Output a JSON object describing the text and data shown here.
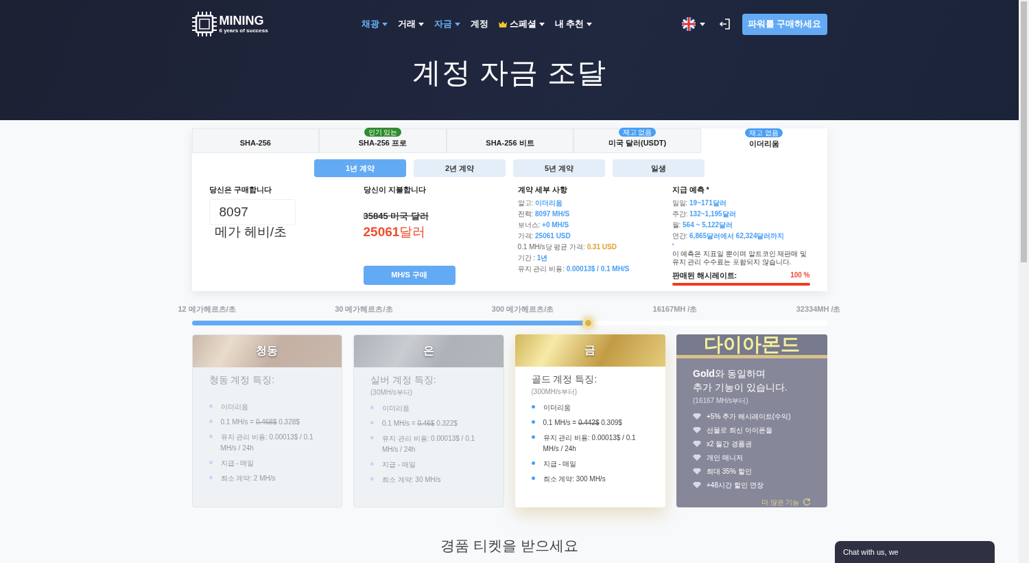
{
  "header": {
    "logo_name": "MINING",
    "logo_tagline": "6 years of success",
    "nav": [
      {
        "label": "채광",
        "selected": true,
        "dropdown": true,
        "crown": false
      },
      {
        "label": "거래",
        "selected": false,
        "dropdown": true,
        "crown": false
      },
      {
        "label": "자금",
        "selected": true,
        "dropdown": true,
        "crown": false
      },
      {
        "label": "계정",
        "selected": false,
        "dropdown": false,
        "crown": false
      },
      {
        "label": "스페셜",
        "selected": false,
        "dropdown": true,
        "crown": true
      },
      {
        "label": "내 추천",
        "selected": false,
        "dropdown": true,
        "crown": false
      }
    ],
    "buy_button": "파워를 구매하세요",
    "title": "계정 자금 조달"
  },
  "algo_tabs": [
    {
      "label": "SHA-256",
      "selected": false
    },
    {
      "label": "SHA-256 프로",
      "selected": false,
      "badge": "인기 있는",
      "color": "#2e8b2e"
    },
    {
      "label": "SHA-256 비트",
      "selected": false
    },
    {
      "label": "미국 달러(USDT)",
      "selected": false,
      "badge": "재고 없음",
      "color": "#4a9ff5"
    },
    {
      "label": "이더리움",
      "selected": true,
      "badge": "재고 없음",
      "color": "#4a9ff5"
    }
  ],
  "term_tabs": [
    {
      "label": "1년 계약",
      "selected": true
    },
    {
      "label": "2년 계약",
      "selected": false
    },
    {
      "label": "5년 계약",
      "selected": false
    },
    {
      "label": "일생",
      "selected": false
    }
  ],
  "buy": {
    "heading": "당신은 구매합니다",
    "value": "8097",
    "unit": "메가 헤비/초"
  },
  "pay": {
    "heading": "당신이 지불합니다",
    "old_price": "35845 미국 달러",
    "price": "25061",
    "currency": "달러",
    "button": "MH/S 구매"
  },
  "details": {
    "heading": "계약 세부 사항",
    "items": [
      {
        "label": "알고: ",
        "value": "이더리움",
        "color": "#4a9ff5"
      },
      {
        "label": "전력: ",
        "value": "8097 MH/S",
        "color": "#4a9ff5"
      },
      {
        "label": "보너스: ",
        "value": "+0 MH/S",
        "color": "#4a9ff5"
      },
      {
        "label": "가격: ",
        "value": "25061 USD",
        "color": "#4a9ff5"
      },
      {
        "label": "0.1 MH/s당 평균 가격: ",
        "value": "0.31 USD",
        "color": "#e0a030"
      },
      {
        "label": "기간 : ",
        "value": "1년",
        "color": "#4a9ff5"
      },
      {
        "label": "유지 관리 비용: ",
        "value": "0.00013$ / 0.1 MH/S",
        "color": "#4a9ff5"
      }
    ]
  },
  "forecast": {
    "heading": "지급 예측 *",
    "items": [
      {
        "label": "일일: ",
        "value": "19~171달러"
      },
      {
        "label": "주간: ",
        "value": "132~1,195달러"
      },
      {
        "label": "월: ",
        "value": "564 ~ 5,122달러"
      },
      {
        "label": "연간: ",
        "value": "6,865달러에서 62,324달러까지"
      }
    ],
    "star": "*",
    "note": "이 예측은 지표일 뿐이며 알트코인 재판매 및 유지 관리 수수료는 포함되지 않습니다.",
    "sold_label": "판매된 해시레이트:",
    "sold_value": "100 %",
    "level": 1
  },
  "slider": {
    "ticks": [
      "12 메가헤르츠/초",
      "30 메가헤르츠/초",
      "300 메가헤르츠/초",
      "16167MH /초",
      "32334MH /초"
    ],
    "level": 0.624
  },
  "plans": [
    {
      "kind": "bronze",
      "selected": false,
      "name": "청동",
      "heading": "청동 계정 특징:",
      "features": [
        {
          "text": "이더리움"
        },
        {
          "text": "0.1 MH/s = ",
          "old": "0.468$",
          "after": " 0.328$"
        },
        {
          "text": "유지 관리 비용: 0.00013$ / 0.1 MH/s / 24h"
        },
        {
          "text": "지급 - 매일"
        },
        {
          "text": "최소 계약: 2 MH/s"
        }
      ]
    },
    {
      "kind": "silver",
      "selected": false,
      "name": "은",
      "heading": "실버 계정 특징:",
      "sub": "(30MH/s부터)",
      "features": [
        {
          "text": "이더리움"
        },
        {
          "text": "0.1 MH/s = ",
          "old": "0.46$",
          "after": " 0.322$"
        },
        {
          "text": "유지 관리 비용: 0.00013$ / 0.1 MH/s / 24h"
        },
        {
          "text": "지급 - 매일"
        },
        {
          "text": "최소 계약: 30 MH/s"
        }
      ]
    },
    {
      "kind": "gold",
      "selected": true,
      "name": "금",
      "heading": "골드 계정 특징:",
      "sub": "(300MH/s부터)",
      "features": [
        {
          "text": "이더리움"
        },
        {
          "text": "0.1 MH/s = ",
          "old": "0.442$",
          "after": " 0.309$"
        },
        {
          "text": "유지 관리 비용: 0.00013$ / 0.1 MH/s / 24h"
        },
        {
          "text": "지급 - 매일"
        },
        {
          "text": "최소 계약: 300 MH/s"
        }
      ]
    },
    {
      "kind": "diamond",
      "selected": false,
      "name": "다이아몬드",
      "lines": [
        "**Gold**와 동일하며",
        "추가 기능이 있습니다."
      ],
      "sub": "(16167 MH/s부터)",
      "features": [
        {
          "text": "+5% 추가 해시레이트(수익)"
        },
        {
          "text": "선물로 최신 아이폰을"
        },
        {
          "text": "x2 월간 경품권"
        },
        {
          "text": "개인 매니저"
        },
        {
          "text": "최대 35% 할인"
        },
        {
          "text": "+48시간 할인 연장"
        }
      ],
      "more": "더 많은 기능"
    }
  ],
  "tickets_heading": "경품 티켓을 받으세요",
  "chat": "Chat with us, we"
}
